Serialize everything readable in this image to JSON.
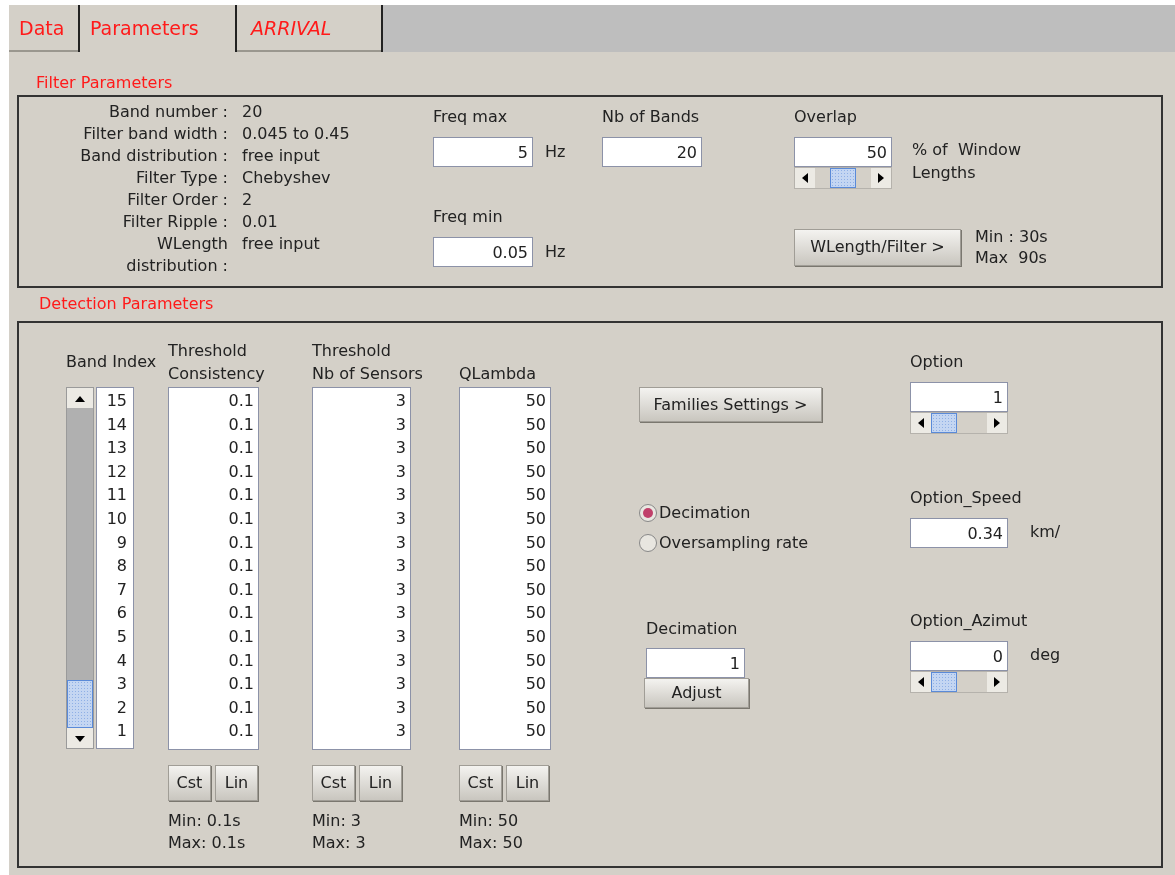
{
  "tabs": [
    {
      "label": "Data",
      "selected": false,
      "italic": false
    },
    {
      "label": "Parameters",
      "selected": true,
      "italic": false
    },
    {
      "label": "ARRIVAL",
      "selected": false,
      "italic": true
    }
  ],
  "filter_parameters": {
    "title": "Filter Parameters",
    "info": [
      {
        "label": [
          "Band number :"
        ],
        "value": "20"
      },
      {
        "label": [
          "Filter band width :"
        ],
        "value": "0.045 to 0.45"
      },
      {
        "label": [
          "Band distribution :"
        ],
        "value": "free input"
      },
      {
        "label": [
          "Filter Type :"
        ],
        "value": "Chebyshev"
      },
      {
        "label": [
          "Filter Order :"
        ],
        "value": "2"
      },
      {
        "label": [
          "Filter Ripple :"
        ],
        "value": "0.01"
      },
      {
        "label": [
          "WLength",
          "distribution :"
        ],
        "value": "free input"
      }
    ],
    "freq_max": {
      "label": "Freq max",
      "value": "5",
      "unit": "Hz"
    },
    "freq_min": {
      "label": "Freq min",
      "value": "0.05",
      "unit": "Hz"
    },
    "nb_of_bands": {
      "label": "Nb of Bands",
      "value": "20"
    },
    "overlap": {
      "label": "Overlap",
      "value": "50",
      "level": 0.5,
      "unit": [
        "% of  Window",
        "Lengths"
      ]
    },
    "wlength_button": "WLength/Filter >",
    "wlength_range": [
      "Min : 30s",
      "Max  90s"
    ]
  },
  "detection_parameters": {
    "title": "Detection Parameters",
    "band_index": {
      "label": "Band Index",
      "values": [
        "15",
        "14",
        "13",
        "12",
        "11",
        "10",
        "9",
        "8",
        "7",
        "6",
        "5",
        "4",
        "3",
        "2",
        "1"
      ]
    },
    "columns": [
      {
        "label": [
          "Threshold",
          "Consistency"
        ],
        "values": [
          "0.1",
          "0.1",
          "0.1",
          "0.1",
          "0.1",
          "0.1",
          "0.1",
          "0.1",
          "0.1",
          "0.1",
          "0.1",
          "0.1",
          "0.1",
          "0.1",
          "0.1"
        ],
        "buttons": [
          "Cst",
          "Lin"
        ],
        "range": [
          "Min: 0.1s",
          "Max: 0.1s"
        ]
      },
      {
        "label": [
          "Threshold",
          "Nb of Sensors"
        ],
        "values": [
          "3",
          "3",
          "3",
          "3",
          "3",
          "3",
          "3",
          "3",
          "3",
          "3",
          "3",
          "3",
          "3",
          "3",
          "3"
        ],
        "buttons": [
          "Cst",
          "Lin"
        ],
        "range": [
          "Min: 3",
          "Max: 3"
        ]
      },
      {
        "label": [
          "QLambda"
        ],
        "values": [
          "50",
          "50",
          "50",
          "50",
          "50",
          "50",
          "50",
          "50",
          "50",
          "50",
          "50",
          "50",
          "50",
          "50",
          "50"
        ],
        "buttons": [
          "Cst",
          "Lin"
        ],
        "range": [
          "Min: 50",
          "Max: 50"
        ]
      }
    ],
    "families_button": "Families Settings >",
    "sampling": [
      {
        "label": "Decimation",
        "selected": true
      },
      {
        "label": "Oversampling rate",
        "selected": false
      }
    ],
    "decimation": {
      "label": "Decimation",
      "value": "1",
      "button": "Adjust"
    },
    "option": {
      "label": "Option",
      "value": "1",
      "level": 0
    },
    "option_speed": {
      "label": "Option_Speed",
      "value": "0.34",
      "unit": "km/"
    },
    "option_azimut": {
      "label": "Option_Azimut",
      "value": "0",
      "unit": "deg",
      "level": 0
    }
  }
}
